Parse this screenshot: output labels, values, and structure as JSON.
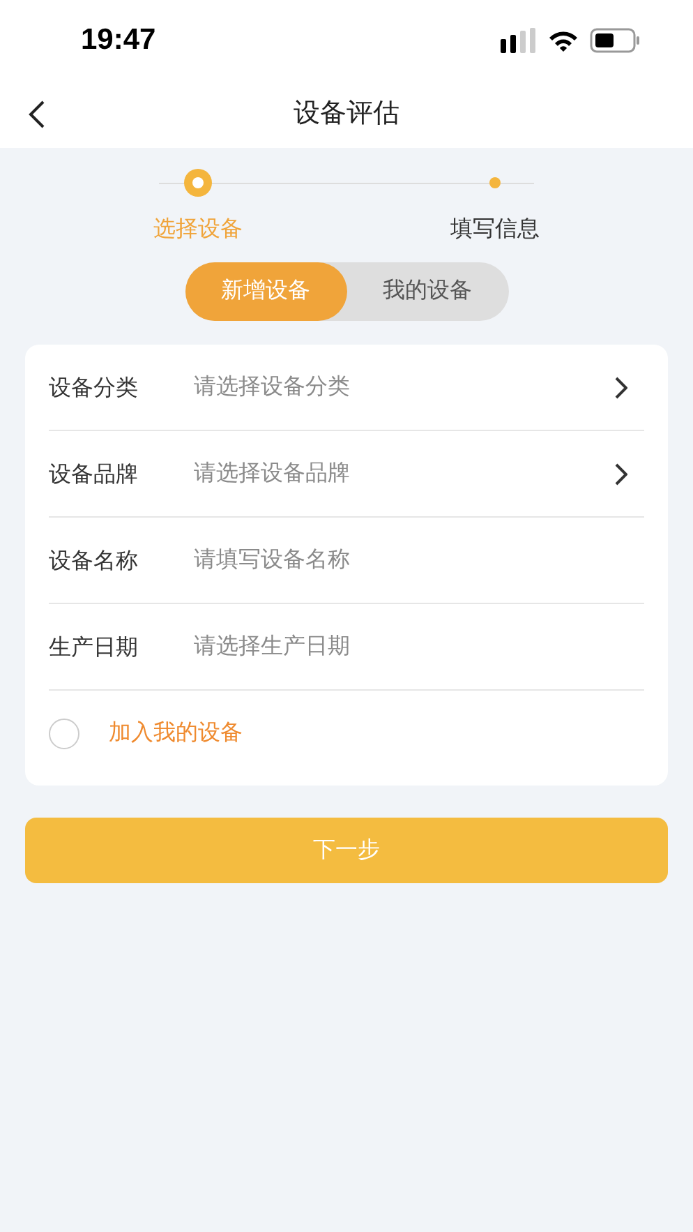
{
  "status_bar": {
    "time": "19:47"
  },
  "nav": {
    "title": "设备评估"
  },
  "steps": [
    {
      "label": "选择设备",
      "selected": true
    },
    {
      "label": "填写信息",
      "selected": false
    }
  ],
  "segments": [
    {
      "label": "新增设备",
      "selected": true
    },
    {
      "label": "我的设备",
      "selected": false
    }
  ],
  "fields": [
    {
      "kind": "select",
      "label": "设备分类",
      "placeholder": "请选择设备分类"
    },
    {
      "kind": "select",
      "label": "设备品牌",
      "placeholder": "请选择设备品牌"
    },
    {
      "kind": "input",
      "label": "设备名称",
      "placeholder": "请填写设备名称"
    },
    {
      "kind": "input",
      "label": "生产日期",
      "placeholder": "请选择生产日期"
    }
  ],
  "add_to_my_devices": {
    "label": "加入我的设备",
    "checked": false
  },
  "next_button": {
    "label": "下一步"
  }
}
